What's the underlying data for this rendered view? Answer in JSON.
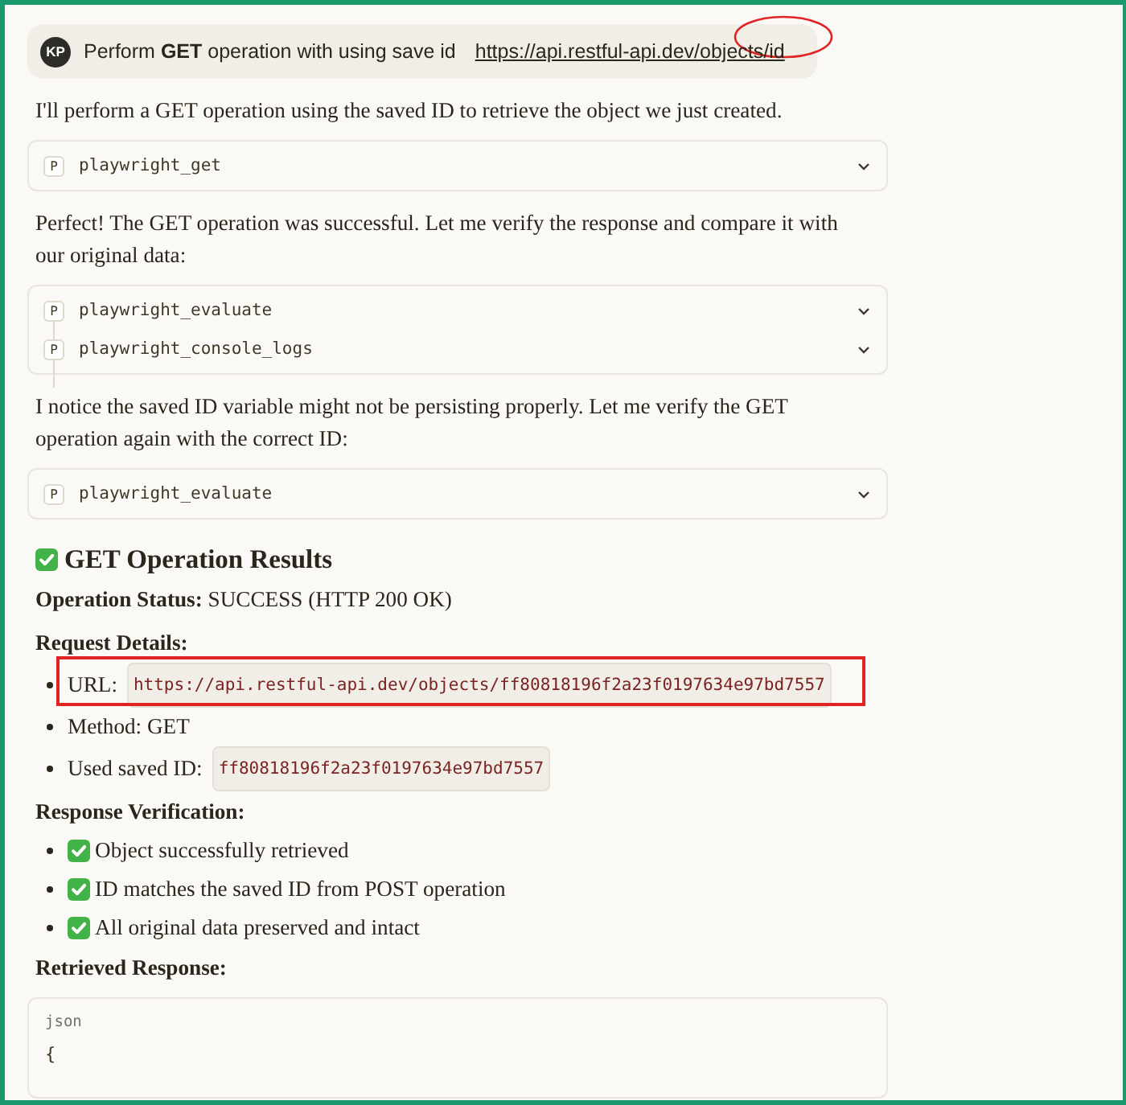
{
  "user_message": {
    "avatar": "KP",
    "text": "Perform **GET** operation with using save id",
    "link": "https://api.restful-api.dev/objects/id",
    "link_circled": true
  },
  "blocks": [
    {
      "kind": "paragraph",
      "text": "I'll perform a GET operation using the saved ID to retrieve the object we just created."
    },
    {
      "kind": "tools",
      "tools": [
        {
          "badge": "P",
          "name": "playwright_get"
        }
      ]
    },
    {
      "kind": "paragraph",
      "text": "Perfect! The GET operation was successful. Let me verify the response and compare it with our original data:"
    },
    {
      "kind": "tools",
      "tools": [
        {
          "badge": "P",
          "name": "playwright_evaluate"
        },
        {
          "badge": "P",
          "name": "playwright_console_logs"
        }
      ]
    },
    {
      "kind": "paragraph",
      "text": "I notice the saved ID variable might not be persisting properly. Let me verify the GET operation again with the correct ID:"
    },
    {
      "kind": "tools",
      "tools": [
        {
          "badge": "P",
          "name": "playwright_evaluate"
        }
      ]
    },
    {
      "kind": "heading",
      "text": "GET Operation Results",
      "check": true
    },
    {
      "kind": "status",
      "label": "Operation Status:",
      "text": "SUCCESS (HTTP 200 OK)"
    },
    {
      "kind": "subheading",
      "text": "Request Details:"
    },
    {
      "kind": "list",
      "items": [
        {
          "text": "URL:",
          "code": "https://api.restful-api.dev/objects/ff80818196f2a23f0197634e97bd7557",
          "check": false,
          "highlighted": true
        },
        {
          "text": "Method: GET",
          "check": false,
          "highlighted": false
        },
        {
          "text": "Used saved ID:",
          "code": "ff80818196f2a23f0197634e97bd7557",
          "check": false,
          "highlighted": false
        }
      ]
    },
    {
      "kind": "subheading",
      "text": "Response Verification:"
    },
    {
      "kind": "list",
      "items": [
        {
          "text": "Object successfully retrieved",
          "check": true,
          "highlighted": false
        },
        {
          "text": "ID matches the saved ID from POST operation",
          "check": true,
          "highlighted": false
        },
        {
          "text": "All original data preserved and intact",
          "check": true,
          "highlighted": false
        }
      ]
    },
    {
      "kind": "subheading",
      "text": "Retrieved Response:"
    },
    {
      "kind": "code",
      "language": "json",
      "lines": [
        "{"
      ]
    }
  ]
}
